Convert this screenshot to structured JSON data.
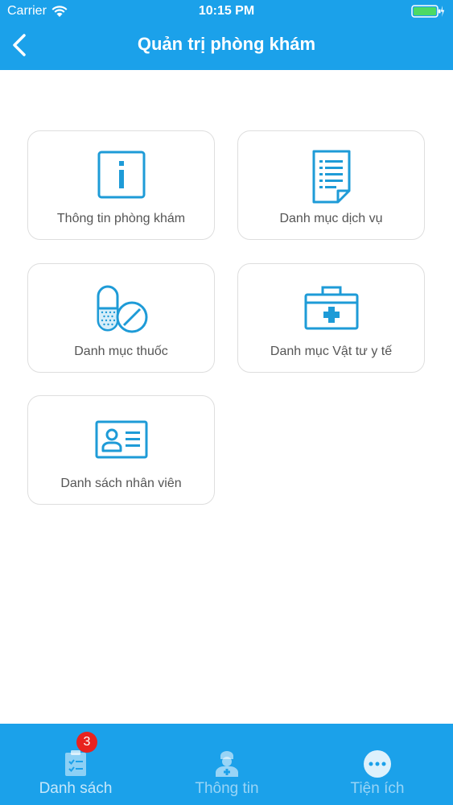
{
  "status_bar": {
    "carrier": "Carrier",
    "time": "10:15 PM",
    "wifi_icon": "wifi-icon",
    "battery_icon": "battery-icon"
  },
  "nav": {
    "title": "Quản trị phòng khám",
    "back_icon": "chevron-left-icon"
  },
  "menu": {
    "items": [
      {
        "label": "Thông tin phòng khám",
        "icon": "info-icon"
      },
      {
        "label": "Danh mục dịch vụ",
        "icon": "document-list-icon"
      },
      {
        "label": "Danh mục thuốc",
        "icon": "pill-icon"
      },
      {
        "label": "Danh mục Vật tư y tế",
        "icon": "medical-kit-icon"
      },
      {
        "label": "Danh sách nhân viên",
        "icon": "id-card-icon"
      }
    ]
  },
  "tabbar": {
    "tabs": [
      {
        "label": "Danh sách",
        "icon": "clipboard-icon",
        "badge": "3"
      },
      {
        "label": "Thông tin",
        "icon": "doctor-icon"
      },
      {
        "label": "Tiện ích",
        "icon": "more-icon"
      }
    ]
  },
  "colors": {
    "primary": "#1ba1ea",
    "icon_blue": "#1e9bd7",
    "badge": "#e8221f"
  }
}
